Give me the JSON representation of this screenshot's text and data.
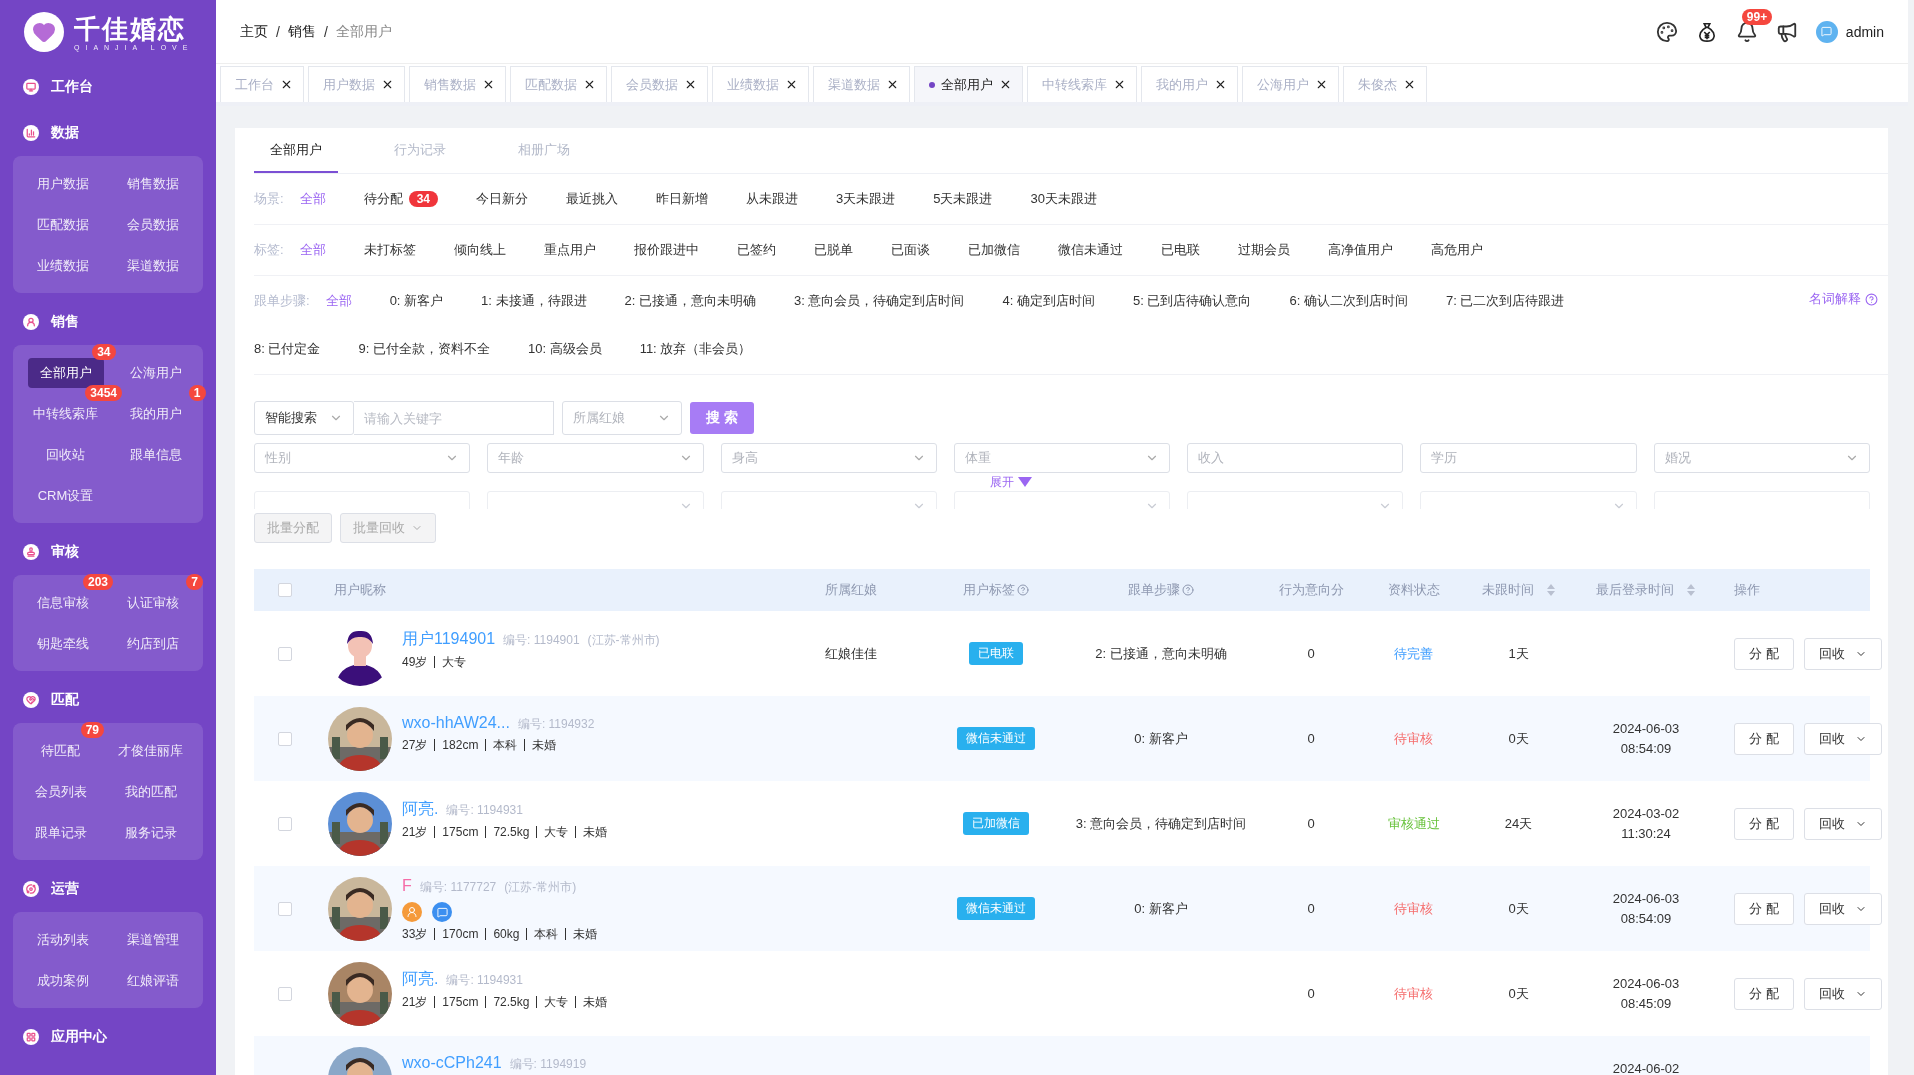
{
  "brand": {
    "name": "千佳婚恋",
    "tagline": "QIANJIA LOVE"
  },
  "sidebar": {
    "sections": [
      {
        "title": "工作台",
        "kind": "workbench"
      },
      {
        "title": "数据",
        "kind": "data",
        "items": [
          {
            "label": "用户数据",
            "selected": false
          },
          {
            "label": "销售数据",
            "selected": false
          },
          {
            "label": "匹配数据",
            "selected": false
          },
          {
            "label": "会员数据",
            "selected": false
          },
          {
            "label": "业绩数据",
            "selected": false
          },
          {
            "label": "渠道数据",
            "selected": false
          }
        ]
      },
      {
        "title": "销售",
        "kind": "sales",
        "items": [
          {
            "label": "全部用户",
            "selected": true,
            "badge": "34"
          },
          {
            "label": "公海用户",
            "selected": false
          },
          {
            "label": "中转线索库",
            "selected": false,
            "badge": "3454"
          },
          {
            "label": "我的用户",
            "selected": false,
            "badge": "1"
          },
          {
            "label": "回收站",
            "selected": false
          },
          {
            "label": "跟单信息",
            "selected": false
          },
          {
            "label": "CRM设置",
            "selected": false
          }
        ]
      },
      {
        "title": "审核",
        "kind": "review",
        "items": [
          {
            "label": "信息审核",
            "selected": false,
            "badge": "203"
          },
          {
            "label": "认证审核",
            "selected": false,
            "badge": "7"
          },
          {
            "label": "钥匙牵线",
            "selected": false
          },
          {
            "label": "约店到店",
            "selected": false
          }
        ]
      },
      {
        "title": "匹配",
        "kind": "match",
        "items": [
          {
            "label": "待匹配",
            "selected": false,
            "badge": "79"
          },
          {
            "label": "才俊佳丽库",
            "selected": false
          },
          {
            "label": "会员列表",
            "selected": false
          },
          {
            "label": "我的匹配",
            "selected": false
          },
          {
            "label": "跟单记录",
            "selected": false
          },
          {
            "label": "服务记录",
            "selected": false
          }
        ]
      },
      {
        "title": "运营",
        "kind": "ops",
        "items": [
          {
            "label": "活动列表",
            "selected": false
          },
          {
            "label": "渠道管理",
            "selected": false
          },
          {
            "label": "成功案例",
            "selected": false
          },
          {
            "label": "红娘评语",
            "selected": false
          }
        ]
      },
      {
        "title": "应用中心",
        "kind": "apps"
      }
    ]
  },
  "header": {
    "breadcrumb": [
      "主页",
      "销售",
      "全部用户"
    ],
    "separator": "/",
    "notification_badge": "99+",
    "user": "admin"
  },
  "tabs": [
    {
      "label": "工作台",
      "selected": false
    },
    {
      "label": "用户数据",
      "selected": false
    },
    {
      "label": "销售数据",
      "selected": false
    },
    {
      "label": "匹配数据",
      "selected": false
    },
    {
      "label": "会员数据",
      "selected": false
    },
    {
      "label": "业绩数据",
      "selected": false
    },
    {
      "label": "渠道数据",
      "selected": false
    },
    {
      "label": "全部用户",
      "selected": true
    },
    {
      "label": "中转线索库",
      "selected": false
    },
    {
      "label": "我的用户",
      "selected": false
    },
    {
      "label": "公海用户",
      "selected": false
    },
    {
      "label": "朱俊杰",
      "selected": false
    }
  ],
  "sub_tabs": [
    {
      "label": "全部用户",
      "selected": true
    },
    {
      "label": "行为记录",
      "selected": false
    },
    {
      "label": "相册广场",
      "selected": false
    }
  ],
  "filters": [
    {
      "label": "场景:",
      "options": [
        {
          "label": "全部",
          "selected": true
        },
        {
          "label": "待分配",
          "selected": false,
          "badge": "34"
        },
        {
          "label": "今日新分",
          "selected": false
        },
        {
          "label": "最近挑入",
          "selected": false
        },
        {
          "label": "昨日新增",
          "selected": false
        },
        {
          "label": "从未跟进",
          "selected": false
        },
        {
          "label": "3天未跟进",
          "selected": false
        },
        {
          "label": "5天未跟进",
          "selected": false
        },
        {
          "label": "30天未跟进",
          "selected": false
        }
      ]
    },
    {
      "label": "标签:",
      "options": [
        {
          "label": "全部",
          "selected": true
        },
        {
          "label": "未打标签",
          "selected": false
        },
        {
          "label": "倾向线上",
          "selected": false
        },
        {
          "label": "重点用户",
          "selected": false
        },
        {
          "label": "报价跟进中",
          "selected": false
        },
        {
          "label": "已签约",
          "selected": false
        },
        {
          "label": "已脱单",
          "selected": false
        },
        {
          "label": "已面谈",
          "selected": false
        },
        {
          "label": "已加微信",
          "selected": false
        },
        {
          "label": "微信未通过",
          "selected": false
        },
        {
          "label": "已电联",
          "selected": false
        },
        {
          "label": "过期会员",
          "selected": false
        },
        {
          "label": "高净值用户",
          "selected": false
        },
        {
          "label": "高危用户",
          "selected": false
        }
      ]
    },
    {
      "label": "跟单步骤:",
      "help": "名词解释",
      "options": [
        {
          "label": "全部",
          "selected": true
        },
        {
          "label": "0: 新客户",
          "selected": false
        },
        {
          "label": "1: 未接通，待跟进",
          "selected": false
        },
        {
          "label": "2: 已接通，意向未明确",
          "selected": false
        },
        {
          "label": "3: 意向会员，待确定到店时间",
          "selected": false
        },
        {
          "label": "4: 确定到店时间",
          "selected": false
        },
        {
          "label": "5: 已到店待确认意向",
          "selected": false
        },
        {
          "label": "6: 确认二次到店时间",
          "selected": false
        },
        {
          "label": "7: 已二次到店待跟进",
          "selected": false
        },
        {
          "label": "8: 已付定金",
          "selected": false
        },
        {
          "label": "9: 已付全款，资料不全",
          "selected": false
        },
        {
          "label": "10: 高级会员",
          "selected": false
        },
        {
          "label": "11: 放弃（非会员）",
          "selected": false
        }
      ]
    }
  ],
  "search": {
    "mode": "智能搜索",
    "placeholder": "请输入关键字",
    "matchmaker": "所属红娘",
    "button": "搜 索"
  },
  "fields": [
    {
      "placeholder": "性别",
      "kind": "select"
    },
    {
      "placeholder": "年龄",
      "kind": "select"
    },
    {
      "placeholder": "身高",
      "kind": "select"
    },
    {
      "placeholder": "体重",
      "kind": "select"
    },
    {
      "placeholder": "收入",
      "kind": "input"
    },
    {
      "placeholder": "学历",
      "kind": "input"
    },
    {
      "placeholder": "婚况",
      "kind": "select"
    }
  ],
  "collapsed_fields": [
    {
      "kind": "input"
    },
    {
      "kind": "select"
    },
    {
      "kind": "select"
    },
    {
      "kind": "select"
    },
    {
      "kind": "select"
    },
    {
      "kind": "select"
    },
    {
      "kind": "input"
    }
  ],
  "expand": "展开",
  "batch_buttons": [
    {
      "label": "批量分配",
      "disabled": true,
      "kind": "plain"
    },
    {
      "label": "批量回收",
      "disabled": true,
      "kind": "dropdown"
    }
  ],
  "table": {
    "select_all": {
      "checked": false
    },
    "columns": [
      {
        "label": "用户昵称"
      },
      {
        "label": "所属红娘"
      },
      {
        "label": "用户标签",
        "help": true
      },
      {
        "label": "跟单步骤",
        "help": true
      },
      {
        "label": "行为意向分"
      },
      {
        "label": "资料状态"
      },
      {
        "label": "未跟时间",
        "sortable": true
      },
      {
        "label": "最后登录时间",
        "sortable": true
      },
      {
        "label": "操作"
      }
    ],
    "rows": [
      {
        "selected": false,
        "avatar": {
          "kind": "illustration"
        },
        "name": "用户1194901",
        "color": "#409eff",
        "id": "编号: 1194901",
        "region": "(江苏-常州市)",
        "meta": [
          "49岁",
          "大专"
        ],
        "matchmaker": "红娘佳佳",
        "tag": "已电联",
        "step": "2: 已接通，意向未明确",
        "score": "0",
        "status": {
          "text": "待完善",
          "kind": "incomplete"
        },
        "days": "1天",
        "assign": "分 配",
        "recycle": "回收"
      },
      {
        "selected": false,
        "avatar": {
          "kind": "picture"
        },
        "name": "wxo-hhAW24...",
        "color": "#409eff",
        "id": "编号: 1194932",
        "meta": [
          "27岁",
          "182cm",
          "本科",
          "未婚"
        ],
        "tag": "微信未通过",
        "step": "0: 新客户",
        "score": "0",
        "status": {
          "text": "待审核",
          "kind": "pending"
        },
        "days": "0天",
        "login": [
          "2024-06-03",
          "08:54:09"
        ],
        "assign": "分 配",
        "recycle": "回收"
      },
      {
        "selected": false,
        "avatar": {
          "kind": "picture"
        },
        "name": "阿亮.",
        "color": "#409eff",
        "id": "编号: 1194931",
        "meta": [
          "21岁",
          "175cm",
          "72.5kg",
          "大专",
          "未婚"
        ],
        "tag": "已加微信",
        "step": "3: 意向会员，待确定到店时间",
        "score": "0",
        "status": {
          "text": "审核通过",
          "kind": "approved"
        },
        "days": "24天",
        "login": [
          "2024-03-02",
          "11:30:24"
        ],
        "assign": "分 配",
        "recycle": "回收"
      },
      {
        "selected": false,
        "avatar": {
          "kind": "picture"
        },
        "name": "F",
        "color": "#f56ca7",
        "id": "编号: 1177727",
        "region": "(江苏-常州市)",
        "badges": [
          {
            "kind": "person"
          },
          {
            "kind": "chat"
          }
        ],
        "meta": [
          "33岁",
          "170cm",
          "60kg",
          "本科",
          "未婚"
        ],
        "tag": "微信未通过",
        "step": "0: 新客户",
        "score": "0",
        "status": {
          "text": "待审核",
          "kind": "pending"
        },
        "days": "0天",
        "login": [
          "2024-06-03",
          "08:54:09"
        ],
        "assign": "分 配",
        "recycle": "回收"
      },
      {
        "selected": false,
        "avatar": {
          "kind": "picture"
        },
        "name": "阿亮.",
        "color": "#409eff",
        "id": "编号: 1194931",
        "meta": [
          "21岁",
          "175cm",
          "72.5kg",
          "大专",
          "未婚"
        ],
        "score": "0",
        "status": {
          "text": "待审核",
          "kind": "pending"
        },
        "days": "0天",
        "login": [
          "2024-06-03",
          "08:45:09"
        ],
        "assign": "分 配",
        "recycle": "回收"
      },
      {
        "avatar": {
          "kind": "picture"
        },
        "name": "wxo-cCPh241",
        "color": "#409eff",
        "id": "编号: 1194919",
        "login": [
          "2024-06-02"
        ]
      }
    ]
  }
}
